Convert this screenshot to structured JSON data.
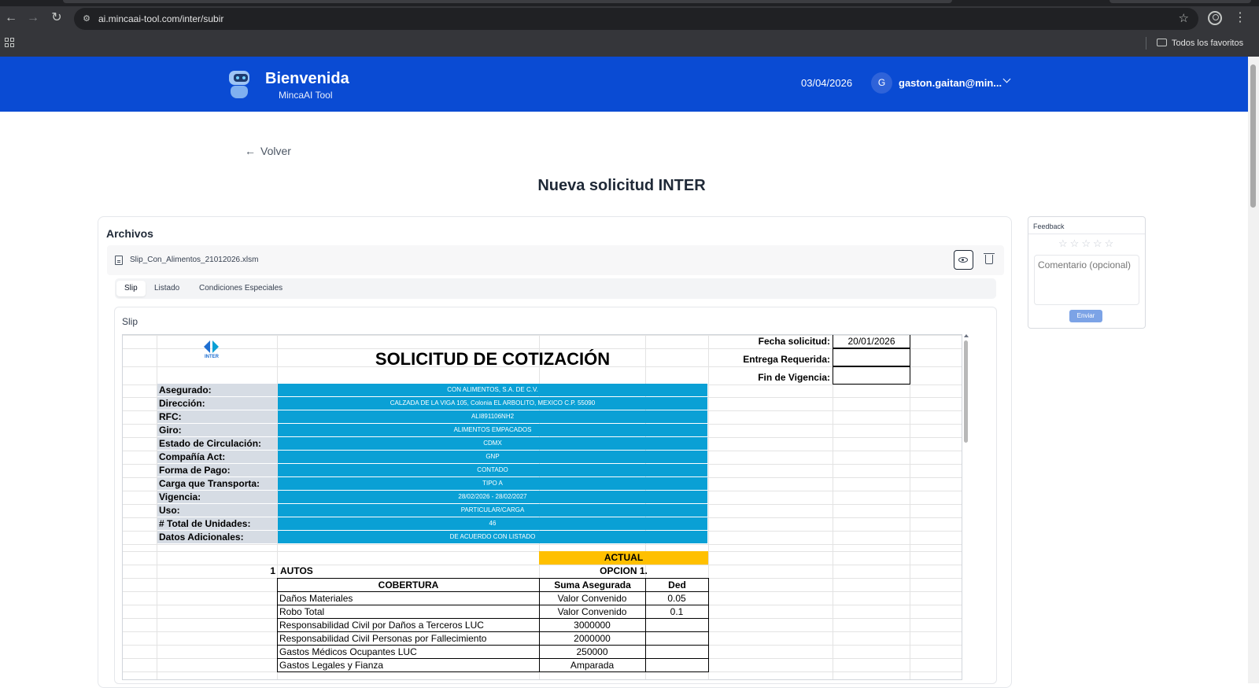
{
  "browser": {
    "url": "ai.mincaai-tool.com/inter/subir",
    "bookmarks_label": "Todos los favoritos"
  },
  "header": {
    "title": "Bienvenida",
    "subtitle": "MincaAI Tool",
    "date": "03/04/2026",
    "avatar_initial": "G",
    "user": "gaston.gaitan@min..."
  },
  "page": {
    "back_label": "Volver",
    "title": "Nueva solicitud INTER"
  },
  "files": {
    "title": "Archivos",
    "file_name": "Slip_Con_Alimentos_21012026.xlsm",
    "tabs": [
      "Slip",
      "Listado",
      "Condiciones Especiales"
    ],
    "active_tab": "Slip",
    "section_title": "Slip"
  },
  "sheet": {
    "heading": "SOLICITUD DE COTIZACIÓN",
    "logo_text": "INTER",
    "meta": [
      {
        "label": "Fecha solicitud:",
        "value": "20/01/2026"
      },
      {
        "label": "Entrega Requerida:",
        "value": ""
      },
      {
        "label": "Fin de Vigencia:",
        "value": ""
      }
    ],
    "fields": [
      {
        "label": "Asegurado:",
        "value": "CON ALIMENTOS, S.A. DE C.V."
      },
      {
        "label": "Dirección:",
        "value": "CALZADA DE LA VIGA 105, Colonia EL ARBOLITO, MEXICO C.P. 55090"
      },
      {
        "label": "RFC:",
        "value": "ALI891106NH2"
      },
      {
        "label": "Giro:",
        "value": "ALIMENTOS EMPACADOS"
      },
      {
        "label": "Estado de Circulación:",
        "value": "CDMX"
      },
      {
        "label": "Compañía Act:",
        "value": "GNP"
      },
      {
        "label": "Forma de Pago:",
        "value": "CONTADO"
      },
      {
        "label": "Carga que Transporta:",
        "value": "TIPO A"
      },
      {
        "label": "Vigencia:",
        "value": "28/02/2026 - 28/02/2027"
      },
      {
        "label": "Uso:",
        "value": "PARTICULAR/CARGA"
      },
      {
        "label": "# Total de Unidades:",
        "value": "46"
      },
      {
        "label": "Datos Adicionales:",
        "value": "DE ACUERDO CON LISTADO"
      }
    ],
    "actual_label": "ACTUAL",
    "section_number": "1",
    "section_name": "AUTOS",
    "option_label": "OPCION 1.",
    "columns": [
      "COBERTURA",
      "Suma Asegurada",
      "Ded"
    ],
    "coverages": [
      {
        "name": "Daños Materiales",
        "sum": "Valor Convenido",
        "ded": "0.05"
      },
      {
        "name": "Robo Total",
        "sum": "Valor Convenido",
        "ded": "0.1"
      },
      {
        "name": "Responsabilidad Civil por Daños a Terceros LUC",
        "sum": "3000000",
        "ded": ""
      },
      {
        "name": "Responsabilidad Civil Personas por Fallecimiento",
        "sum": "2000000",
        "ded": ""
      },
      {
        "name": "Gastos Médicos Ocupantes LUC",
        "sum": "250000",
        "ded": ""
      },
      {
        "name": "Gastos Legales y Fianza",
        "sum": "Amparada",
        "ded": ""
      }
    ]
  },
  "feedback": {
    "title": "Feedback",
    "comment_placeholder": "Comentario (opcional)",
    "send_label": "Enviar"
  },
  "colors": {
    "header_bg": "#0a4bd3",
    "sheet_value_bg": "#0aa0d5",
    "sheet_label_bg": "#d6dce4",
    "actual_bg": "#ffc000"
  }
}
